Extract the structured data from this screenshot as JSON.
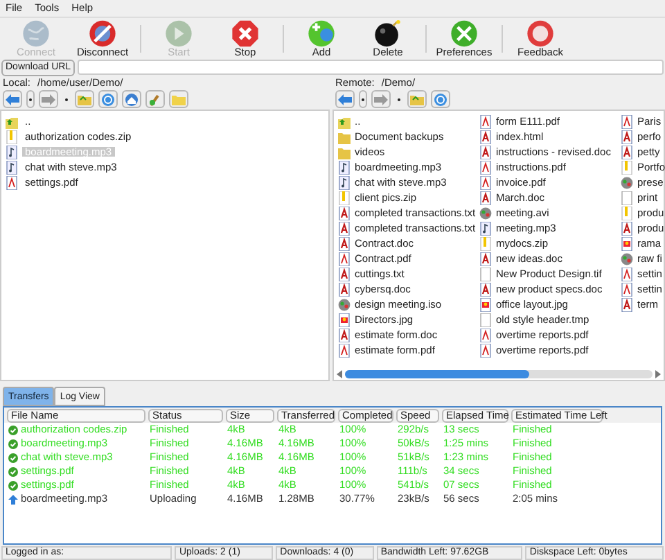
{
  "menu": [
    "File",
    "Tools",
    "Help"
  ],
  "toolbar": [
    {
      "label": "Connect",
      "disabled": true
    },
    {
      "label": "Disconnect",
      "disabled": false
    },
    {
      "label": "Start",
      "disabled": true
    },
    {
      "label": "Stop",
      "disabled": false
    },
    {
      "label": "Add",
      "disabled": false
    },
    {
      "label": "Delete",
      "disabled": false
    },
    {
      "label": "Preferences",
      "disabled": false
    },
    {
      "label": "Feedback",
      "disabled": false
    }
  ],
  "download_url": {
    "button": "Download URL"
  },
  "local": {
    "label": "Local:",
    "path": "/home/user/Demo/",
    "files": [
      {
        "name": "..",
        "kind": "up",
        "selected": false
      },
      {
        "name": "authorization codes.zip",
        "kind": "zip",
        "selected": false
      },
      {
        "name": "boardmeeting.mp3",
        "kind": "audio",
        "selected": true
      },
      {
        "name": "chat with steve.mp3",
        "kind": "audio",
        "selected": false
      },
      {
        "name": "settings.pdf",
        "kind": "pdf",
        "selected": false
      }
    ]
  },
  "remote": {
    "label": "Remote:",
    "path": "/Demo/",
    "files": [
      {
        "name": "..",
        "kind": "up"
      },
      {
        "name": "Document backups",
        "kind": "folder"
      },
      {
        "name": "videos",
        "kind": "folder"
      },
      {
        "name": "boardmeeting.mp3",
        "kind": "audio"
      },
      {
        "name": "chat with steve.mp3",
        "kind": "audio"
      },
      {
        "name": "client pics.zip",
        "kind": "zip"
      },
      {
        "name": "completed transactions.txt",
        "kind": "doc"
      },
      {
        "name": "completed transactions.txt",
        "kind": "doc"
      },
      {
        "name": "Contract.doc",
        "kind": "doc"
      },
      {
        "name": "Contract.pdf",
        "kind": "pdf"
      },
      {
        "name": "cuttings.txt",
        "kind": "doc"
      },
      {
        "name": "cybersq.doc",
        "kind": "doc"
      },
      {
        "name": "design meeting.iso",
        "kind": "iso"
      },
      {
        "name": "Directors.jpg",
        "kind": "image"
      },
      {
        "name": "estimate form.doc",
        "kind": "doc"
      },
      {
        "name": "estimate form.pdf",
        "kind": "pdf"
      },
      {
        "name": "form E111.pdf",
        "kind": "pdf"
      },
      {
        "name": "index.html",
        "kind": "doc"
      },
      {
        "name": "instructions - revised.doc",
        "kind": "doc"
      },
      {
        "name": "instructions.pdf",
        "kind": "pdf"
      },
      {
        "name": "invoice.pdf",
        "kind": "pdf"
      },
      {
        "name": "March.doc",
        "kind": "doc"
      },
      {
        "name": "meeting.avi",
        "kind": "iso"
      },
      {
        "name": "meeting.mp3",
        "kind": "audio"
      },
      {
        "name": "mydocs.zip",
        "kind": "zip"
      },
      {
        "name": "new ideas.doc",
        "kind": "doc"
      },
      {
        "name": "New Product Design.tif",
        "kind": "blank"
      },
      {
        "name": "new product specs.doc",
        "kind": "doc"
      },
      {
        "name": "office layout.jpg",
        "kind": "image"
      },
      {
        "name": "old style header.tmp",
        "kind": "blank"
      },
      {
        "name": "overtime reports.pdf",
        "kind": "pdf"
      },
      {
        "name": "overtime reports.pdf",
        "kind": "pdf"
      },
      {
        "name": "Paris",
        "kind": "pdf"
      },
      {
        "name": "perfo",
        "kind": "doc"
      },
      {
        "name": "petty",
        "kind": "doc"
      },
      {
        "name": "Portfo",
        "kind": "zip"
      },
      {
        "name": "prese",
        "kind": "iso"
      },
      {
        "name": "print",
        "kind": "blank"
      },
      {
        "name": "produ",
        "kind": "zip"
      },
      {
        "name": "produ",
        "kind": "doc"
      },
      {
        "name": "rama",
        "kind": "image"
      },
      {
        "name": "raw fi",
        "kind": "iso"
      },
      {
        "name": "settin",
        "kind": "pdf"
      },
      {
        "name": "settin",
        "kind": "pdf"
      },
      {
        "name": "term",
        "kind": "doc"
      }
    ]
  },
  "tabs": [
    {
      "label": "Transfers",
      "selected": true
    },
    {
      "label": "Log View",
      "selected": false
    }
  ],
  "transfers": {
    "columns": [
      "File Name",
      "Status",
      "Size",
      "Transferred",
      "Completed",
      "Speed",
      "Elapsed Time",
      "Estimated Time Left"
    ],
    "rows": [
      {
        "kind": "finished",
        "cells": [
          "authorization codes.zip",
          "Finished",
          "4kB",
          "4kB",
          "100%",
          "292b/s",
          "13 secs",
          "Finished"
        ]
      },
      {
        "kind": "finished",
        "cells": [
          "boardmeeting.mp3",
          "Finished",
          "4.16MB",
          "4.16MB",
          "100%",
          "50kB/s",
          "1:25 mins",
          "Finished"
        ]
      },
      {
        "kind": "finished",
        "cells": [
          "chat with steve.mp3",
          "Finished",
          "4.16MB",
          "4.16MB",
          "100%",
          "51kB/s",
          "1:23 mins",
          "Finished"
        ]
      },
      {
        "kind": "finished",
        "cells": [
          "settings.pdf",
          "Finished",
          "4kB",
          "4kB",
          "100%",
          "111b/s",
          "34 secs",
          "Finished"
        ]
      },
      {
        "kind": "finished",
        "cells": [
          "settings.pdf",
          "Finished",
          "4kB",
          "4kB",
          "100%",
          "541b/s",
          "07 secs",
          "Finished"
        ]
      },
      {
        "kind": "uploading",
        "cells": [
          "boardmeeting.mp3",
          "Uploading",
          "4.16MB",
          "1.28MB",
          "30.77%",
          "23kB/s",
          "56 secs",
          "2:05 mins"
        ]
      }
    ]
  },
  "status_bar": [
    "Logged in as:",
    "Uploads: 2 (1)",
    "Downloads: 4 (0)",
    "Bandwidth Left: 97.62GB",
    "Diskspace Left: 0bytes"
  ]
}
